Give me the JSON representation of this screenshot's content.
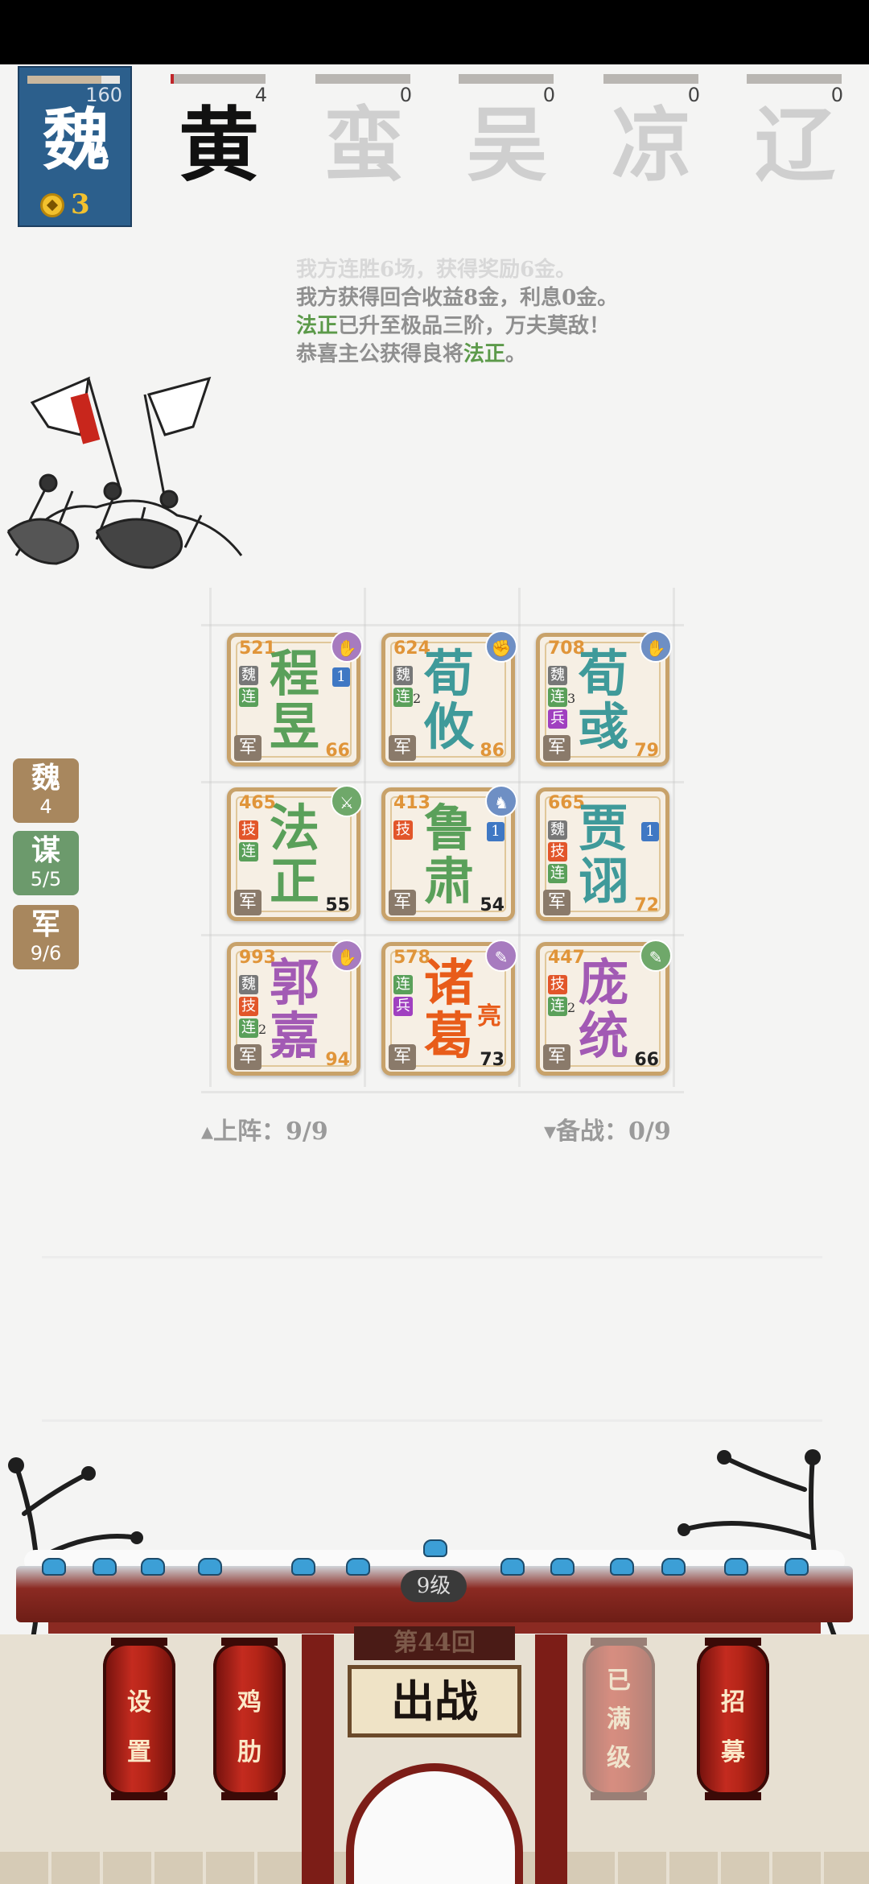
{
  "player": {
    "faction": "魏",
    "hp": "160",
    "hp_fraction": 0.8,
    "coins": "3"
  },
  "enemies": [
    {
      "name": "黄",
      "score": "4",
      "bar_fraction": 0.03,
      "active": true
    },
    {
      "name": "蛮",
      "score": "0",
      "bar_fraction": 0,
      "active": false
    },
    {
      "name": "吴",
      "score": "0",
      "bar_fraction": 0,
      "active": false
    },
    {
      "name": "凉",
      "score": "0",
      "bar_fraction": 0,
      "active": false
    },
    {
      "name": "辽",
      "score": "0",
      "bar_fraction": 0,
      "active": false
    }
  ],
  "log": {
    "line0": "我方连胜6场，获得奖励6金。",
    "line1": "我方获得回合收益8金，利息0金。",
    "line2_name": "法正",
    "line2_rest": "已升至极品三阶，万夫莫敌！",
    "line3_pre": "恭喜主公获得良将",
    "line3_name": "法正",
    "line3_post": "。"
  },
  "side": [
    {
      "label": "魏",
      "value": "4",
      "color": "#a8875e"
    },
    {
      "label": "谋",
      "value": "5/5",
      "color": "#6c9a6c"
    },
    {
      "label": "军",
      "value": "9/6",
      "color": "#a8875e"
    }
  ],
  "cards": [
    {
      "n1": "程",
      "n2": "昱",
      "cost": "521",
      "power": "66",
      "color": "#5aa05a",
      "tags": [
        {
          "t": "魏",
          "c": "#777"
        },
        {
          "t": "连",
          "c": "#5aa05a"
        }
      ],
      "lvl": "1",
      "orb": "#a77bbf",
      "orb_icon": "✋",
      "army": "军",
      "power_color": "#e0953a"
    },
    {
      "n1": "荀",
      "n2": "攸",
      "cost": "624",
      "power": "86",
      "color": "#3f9a9a",
      "tags": [
        {
          "t": "魏",
          "c": "#777"
        },
        {
          "t": "连",
          "c": "#5aa05a",
          "s": "2"
        }
      ],
      "lvl": "",
      "orb": "#6e8fc4",
      "orb_icon": "✊",
      "army": "军",
      "power_color": "#e0953a"
    },
    {
      "n1": "荀",
      "n2": "彧",
      "cost": "708",
      "power": "79",
      "color": "#3f9a9a",
      "tags": [
        {
          "t": "魏",
          "c": "#777"
        },
        {
          "t": "连",
          "c": "#5aa05a",
          "s": "3"
        },
        {
          "t": "兵",
          "c": "#a040c0"
        }
      ],
      "lvl": "",
      "orb": "#6e8fc4",
      "orb_icon": "✋",
      "army": "军",
      "power_color": "#e0953a"
    },
    {
      "n1": "法",
      "n2": "正",
      "cost": "465",
      "power": "55",
      "color": "#5aa05a",
      "tags": [
        {
          "t": "技",
          "c": "#e2562a"
        },
        {
          "t": "连",
          "c": "#5aa05a"
        }
      ],
      "lvl": "",
      "orb": "#6fa86a",
      "orb_icon": "⚔",
      "army": "军",
      "power_color": "#222"
    },
    {
      "n1": "鲁",
      "n2": "肃",
      "cost": "413",
      "power": "54",
      "color": "#5aa05a",
      "tags": [
        {
          "t": "技",
          "c": "#e2562a"
        }
      ],
      "lvl": "1",
      "orb": "#6e8fc4",
      "orb_icon": "♞",
      "army": "军",
      "power_color": "#222"
    },
    {
      "n1": "贾",
      "n2": "诩",
      "cost": "665",
      "power": "72",
      "color": "#3f9a9a",
      "tags": [
        {
          "t": "魏",
          "c": "#777"
        },
        {
          "t": "技",
          "c": "#e2562a"
        },
        {
          "t": "连",
          "c": "#5aa05a"
        }
      ],
      "lvl": "1",
      "orb": "",
      "orb_icon": "",
      "army": "军",
      "power_color": "#e0953a"
    },
    {
      "n1": "郭",
      "n2": "嘉",
      "cost": "993",
      "power": "94",
      "color": "#a25ab4",
      "tags": [
        {
          "t": "魏",
          "c": "#777"
        },
        {
          "t": "技",
          "c": "#e2562a"
        },
        {
          "t": "连",
          "c": "#5aa05a",
          "s": "2"
        }
      ],
      "lvl": "",
      "orb": "#a77bbf",
      "orb_icon": "✋",
      "army": "军",
      "power_color": "#e0953a"
    },
    {
      "n1": "诸",
      "n2": "葛",
      "cost": "578",
      "power": "73",
      "color": "#e85c1a",
      "tags": [
        {
          "t": "连",
          "c": "#5aa05a"
        },
        {
          "t": "兵",
          "c": "#a040c0"
        }
      ],
      "lvl": "",
      "orb": "#a77bbf",
      "orb_icon": "✎",
      "army": "军",
      "power_color": "#222",
      "side_title": "亮"
    },
    {
      "n1": "庞",
      "n2": "统",
      "cost": "447",
      "power": "66",
      "color": "#a25ab4",
      "tags": [
        {
          "t": "技",
          "c": "#e2562a"
        },
        {
          "t": "连",
          "c": "#5aa05a",
          "s": "2"
        }
      ],
      "lvl": "",
      "orb": "#6fa86a",
      "orb_icon": "✎",
      "army": "军",
      "power_color": "#222"
    }
  ],
  "counts": {
    "onfield": "▴上阵：9/9",
    "bench": "▾备战：0/9"
  },
  "gate": {
    "level": "9级",
    "round": "第44回",
    "battle": "出战",
    "settings": [
      "设",
      "置"
    ],
    "chicken_rib": [
      "鸡",
      "肋"
    ],
    "maxed": [
      "已",
      "满",
      "级"
    ],
    "recruit": [
      "招",
      "募"
    ]
  }
}
